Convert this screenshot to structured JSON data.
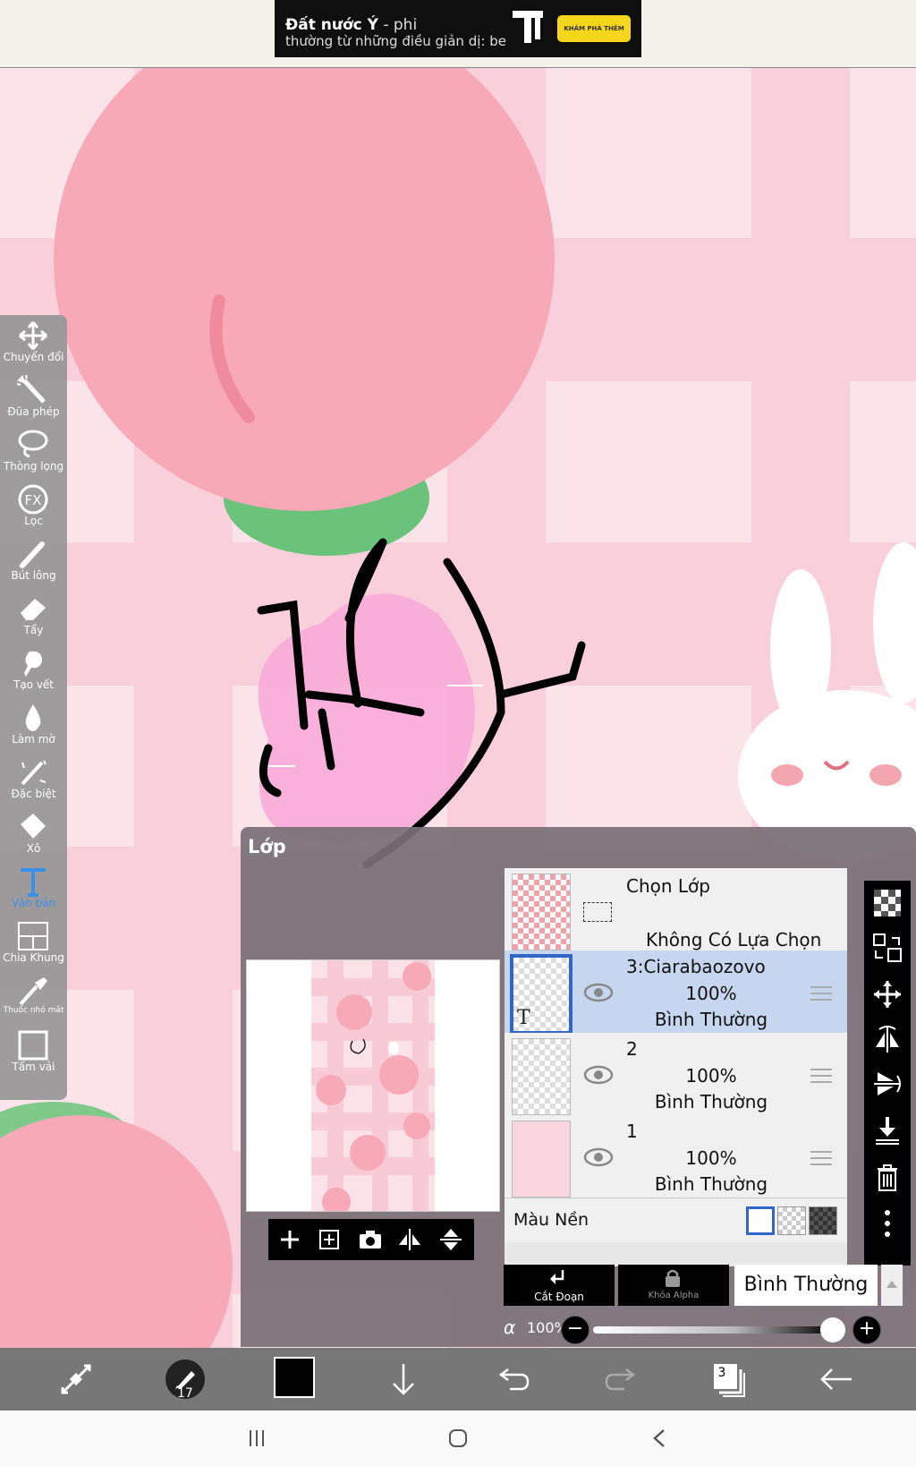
{
  "ad": {
    "headline_bold": "Đất nước Ý",
    "headline_rest": " - phi",
    "subline": "thường từ những điều giản dị: be",
    "cta": "KHÁM PHÁ THÊM"
  },
  "tools": [
    {
      "icon": "move-icon",
      "label": "Chuyển đổi"
    },
    {
      "icon": "magic-wand-icon",
      "label": "Đũa phép"
    },
    {
      "icon": "lasso-icon",
      "label": "Thòng lọng"
    },
    {
      "icon": "fx-filter-icon",
      "label": "Lọc"
    },
    {
      "icon": "brush-icon",
      "label": "Bút lông"
    },
    {
      "icon": "eraser-icon",
      "label": "Tẩy"
    },
    {
      "icon": "smudge-icon",
      "label": "Tạo vết"
    },
    {
      "icon": "blur-drop-icon",
      "label": "Làm mờ"
    },
    {
      "icon": "special-pen-icon",
      "label": "Đặc biệt"
    },
    {
      "icon": "bucket-icon",
      "label": "Xô"
    },
    {
      "icon": "text-tool-icon",
      "label": "Văn bản"
    },
    {
      "icon": "frame-divider-icon",
      "label": "Chia Khung"
    },
    {
      "icon": "eyedropper-icon",
      "label": "Thuốc nhỏ mắt"
    },
    {
      "icon": "canvas-icon",
      "label": "Tấm vải"
    }
  ],
  "panel": {
    "title": "Lớp",
    "select_layer": "Chọn Lớp",
    "no_selection": "Không Có Lựa Chọn",
    "layers": [
      {
        "name": "3:Ciarabaozovo",
        "opacity": "100%",
        "blend": "Bình Thường"
      },
      {
        "name": "2",
        "opacity": "100%",
        "blend": "Bình Thường"
      },
      {
        "name": "1",
        "opacity": "100%",
        "blend": "Bình Thường"
      }
    ],
    "background_label": "Màu Nền",
    "clip_label": "Cắt Đoạn",
    "alpha_lock_label": "Khóa Alpha",
    "blend_mode": "Bình Thường",
    "opacity_symbol": "α",
    "opacity": "100%"
  },
  "bottom": {
    "brush_size": "17",
    "layer_count": "3",
    "color": "#000000"
  },
  "colors": {
    "accent": "#3a8fe8",
    "selected_layer": "#c5d6ee",
    "panel": "#7a7076"
  }
}
